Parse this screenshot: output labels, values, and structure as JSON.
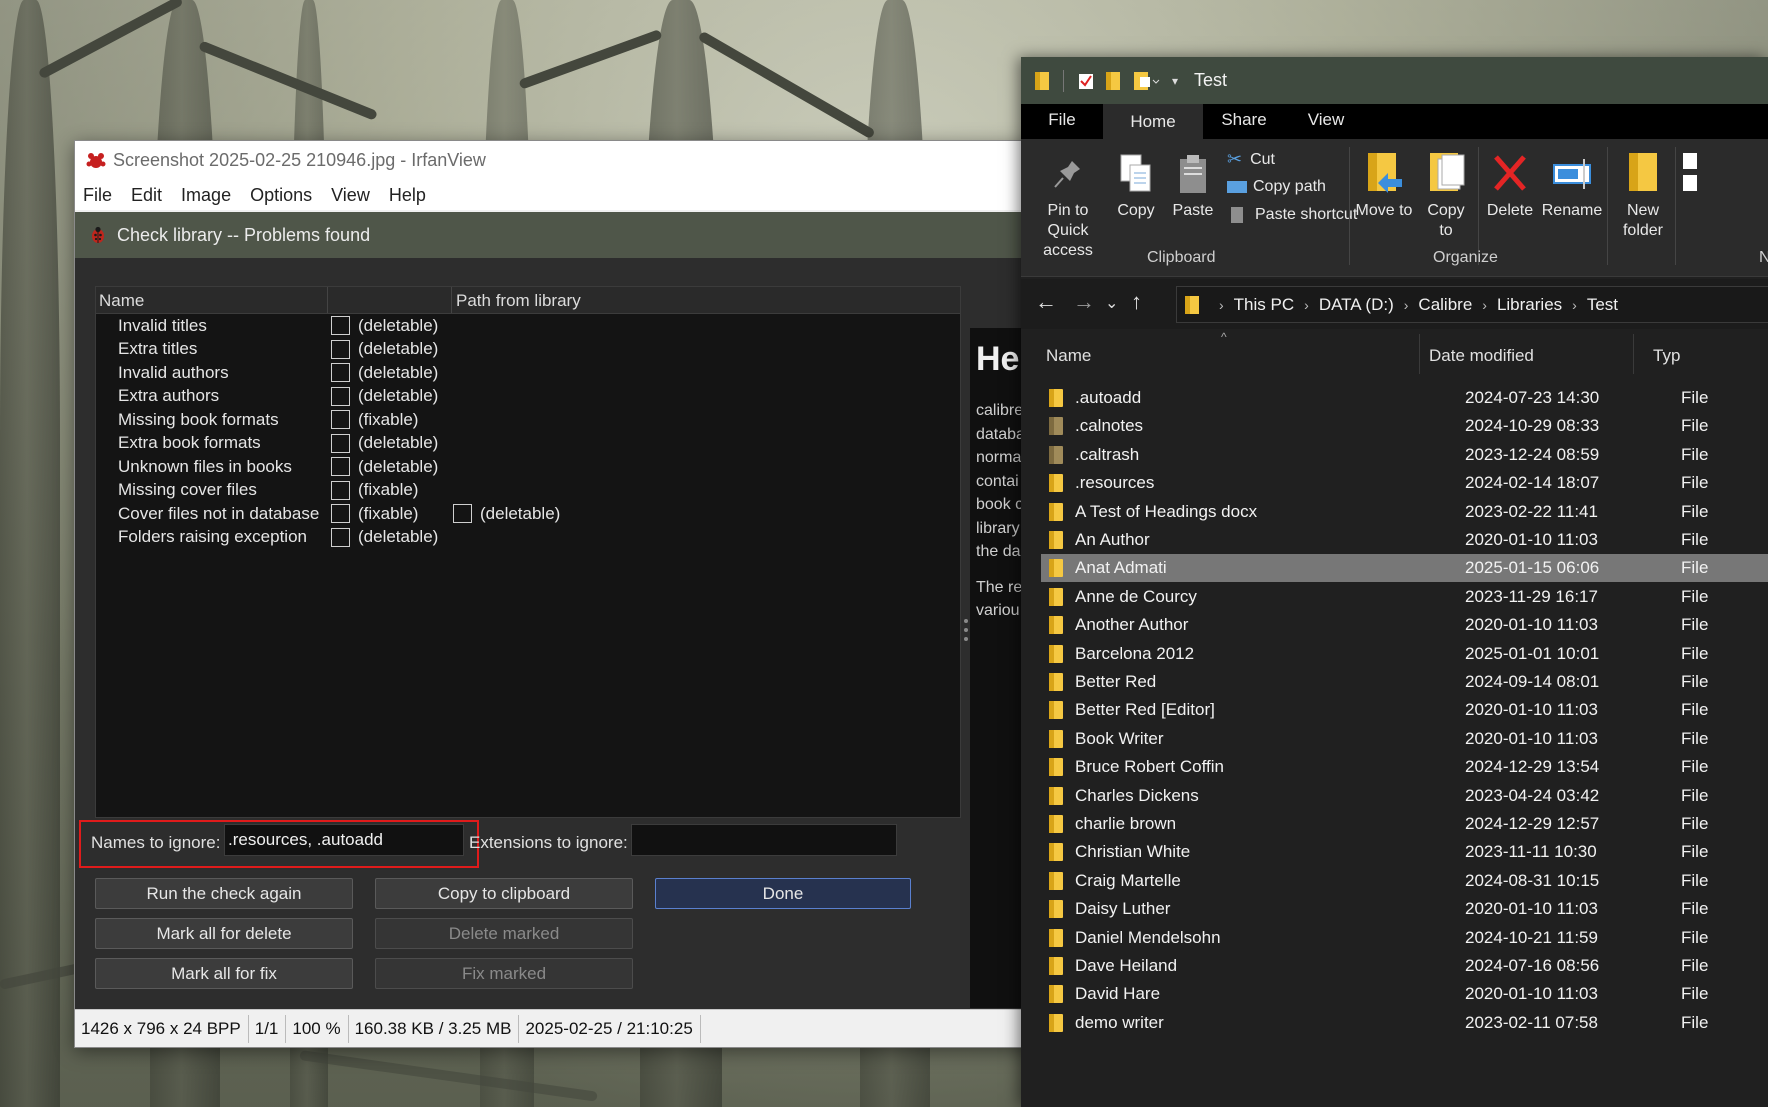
{
  "irfanview": {
    "title": "Screenshot 2025-02-25 210946.jpg - IrfanView",
    "menu": [
      "File",
      "Edit",
      "Image",
      "Options",
      "View",
      "Help"
    ],
    "status": [
      "1426 x 796 x 24 BPP",
      "1/1",
      "100 %",
      "160.38 KB / 3.25 MB",
      "2025-02-25 / 21:10:25"
    ]
  },
  "dialog": {
    "title": "Check library -- Problems found",
    "columns": [
      "Name",
      "Path from library"
    ],
    "rows": [
      {
        "label": "Invalid titles",
        "status": "(deletable)",
        "status2": ""
      },
      {
        "label": "Extra titles",
        "status": "(deletable)",
        "status2": ""
      },
      {
        "label": "Invalid authors",
        "status": "(deletable)",
        "status2": ""
      },
      {
        "label": "Extra authors",
        "status": "(deletable)",
        "status2": ""
      },
      {
        "label": "Missing book formats",
        "status": "(fixable)",
        "status2": ""
      },
      {
        "label": "Extra book formats",
        "status": "(deletable)",
        "status2": ""
      },
      {
        "label": "Unknown files in books",
        "status": "(deletable)",
        "status2": ""
      },
      {
        "label": "Missing cover files",
        "status": "(fixable)",
        "status2": ""
      },
      {
        "label": "Cover files not in database",
        "status": "(fixable)",
        "status2": "(deletable)"
      },
      {
        "label": "Folders raising exception",
        "status": "(deletable)",
        "status2": ""
      }
    ],
    "names_to_ignore_label": "Names to ignore:",
    "names_to_ignore_value": ".resources, .autoadd",
    "extensions_to_ignore_label": "Extensions to ignore:",
    "extensions_to_ignore_value": "",
    "buttons": {
      "run_check": "Run the check again",
      "copy_clipboard": "Copy to clipboard",
      "done": "Done",
      "mark_delete": "Mark all for delete",
      "delete_marked": "Delete marked",
      "mark_fix": "Mark all for fix",
      "fix_marked": "Fix marked"
    },
    "help_heading": "He",
    "help_lines": [
      "calibre",
      "databa",
      "norma",
      "contai",
      "book c",
      "library",
      "the da"
    ],
    "help_lines2": [
      "The re",
      "variou"
    ]
  },
  "explorer": {
    "title": "Test",
    "tabs": [
      "File",
      "Home",
      "Share",
      "View"
    ],
    "ribbon": {
      "pin": "Pin to Quick access",
      "copy": "Copy",
      "paste": "Paste",
      "cut": "Cut",
      "copy_path": "Copy path",
      "paste_shortcut": "Paste shortcut",
      "clipboard_group": "Clipboard",
      "move_to": "Move to",
      "copy_to": "Copy to",
      "delete": "Delete",
      "rename": "Rename",
      "organize_group": "Organize",
      "new_folder": "New folder",
      "new_group_partial": "N"
    },
    "breadcrumb": [
      "This PC",
      "DATA (D:)",
      "Calibre",
      "Libraries",
      "Test"
    ],
    "columns": {
      "name": "Name",
      "date": "Date modified",
      "type": "Typ"
    },
    "files": [
      {
        "name": ".autoadd",
        "date": "2024-07-23 14:30",
        "type": "File",
        "dim": false
      },
      {
        "name": ".calnotes",
        "date": "2024-10-29 08:33",
        "type": "File",
        "dim": true
      },
      {
        "name": ".caltrash",
        "date": "2023-12-24 08:59",
        "type": "File",
        "dim": true
      },
      {
        "name": ".resources",
        "date": "2024-02-14 18:07",
        "type": "File",
        "dim": false
      },
      {
        "name": "A Test of Headings docx",
        "date": "2023-02-22 11:41",
        "type": "File",
        "dim": false
      },
      {
        "name": "An Author",
        "date": "2020-01-10 11:03",
        "type": "File",
        "dim": false
      },
      {
        "name": "Anat Admati",
        "date": "2025-01-15 06:06",
        "type": "File",
        "dim": false,
        "selected": true
      },
      {
        "name": "Anne de Courcy",
        "date": "2023-11-29 16:17",
        "type": "File",
        "dim": false
      },
      {
        "name": "Another Author",
        "date": "2020-01-10 11:03",
        "type": "File",
        "dim": false
      },
      {
        "name": "Barcelona 2012",
        "date": "2025-01-01 10:01",
        "type": "File",
        "dim": false
      },
      {
        "name": "Better Red",
        "date": "2024-09-14 08:01",
        "type": "File",
        "dim": false
      },
      {
        "name": "Better Red [Editor]",
        "date": "2020-01-10 11:03",
        "type": "File",
        "dim": false
      },
      {
        "name": "Book Writer",
        "date": "2020-01-10 11:03",
        "type": "File",
        "dim": false
      },
      {
        "name": "Bruce Robert Coffin",
        "date": "2024-12-29 13:54",
        "type": "File",
        "dim": false
      },
      {
        "name": "Charles Dickens",
        "date": "2023-04-24 03:42",
        "type": "File",
        "dim": false
      },
      {
        "name": "charlie brown",
        "date": "2024-12-29 12:57",
        "type": "File",
        "dim": false
      },
      {
        "name": "Christian White",
        "date": "2023-11-11 10:30",
        "type": "File",
        "dim": false
      },
      {
        "name": "Craig Martelle",
        "date": "2024-08-31 10:15",
        "type": "File",
        "dim": false
      },
      {
        "name": "Daisy Luther",
        "date": "2020-01-10 11:03",
        "type": "File",
        "dim": false
      },
      {
        "name": "Daniel Mendelsohn",
        "date": "2024-10-21 11:59",
        "type": "File",
        "dim": false
      },
      {
        "name": "Dave Heiland",
        "date": "2024-07-16 08:56",
        "type": "File",
        "dim": false
      },
      {
        "name": "David Hare",
        "date": "2020-01-10 11:03",
        "type": "File",
        "dim": false
      },
      {
        "name": "demo writer",
        "date": "2023-02-11 07:58",
        "type": "File",
        "dim": false
      }
    ]
  }
}
